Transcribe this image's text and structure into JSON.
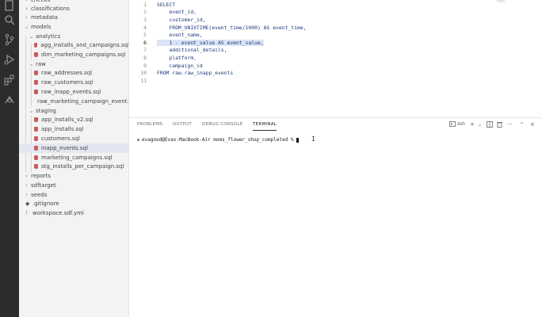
{
  "explorer": {
    "items": [
      {
        "label": "checks",
        "kind": "folder",
        "expanded": false
      },
      {
        "label": "classifications",
        "kind": "folder",
        "expanded": false
      },
      {
        "label": "metadata",
        "kind": "folder",
        "expanded": false
      },
      {
        "label": "models",
        "kind": "folder",
        "expanded": true
      },
      {
        "label": "analytics",
        "kind": "folder",
        "expanded": true
      },
      {
        "label": "agg_installs_and_campaigns.sql",
        "kind": "sql"
      },
      {
        "label": "dim_marketing_campaigns.sql",
        "kind": "sql"
      },
      {
        "label": "raw",
        "kind": "folder",
        "expanded": true
      },
      {
        "label": "raw_addresses.sql",
        "kind": "sql"
      },
      {
        "label": "raw_customers.sql",
        "kind": "sql"
      },
      {
        "label": "raw_inapp_events.sql",
        "kind": "sql"
      },
      {
        "label": "raw_marketing_campaign_event...",
        "kind": "sql"
      },
      {
        "label": "staging",
        "kind": "folder",
        "expanded": true
      },
      {
        "label": "app_installs_v2.sql",
        "kind": "sql"
      },
      {
        "label": "app_installs.sql",
        "kind": "sql"
      },
      {
        "label": "customers.sql",
        "kind": "sql"
      },
      {
        "label": "inapp_events.sql",
        "kind": "sql",
        "selected": true
      },
      {
        "label": "marketing_campaigns.sql",
        "kind": "sql"
      },
      {
        "label": "stg_installs_per_campaign.sql",
        "kind": "sql"
      },
      {
        "label": "reports",
        "kind": "folder",
        "expanded": false
      },
      {
        "label": "sdftarget",
        "kind": "folder",
        "expanded": false
      },
      {
        "label": "seeds",
        "kind": "folder",
        "expanded": false
      },
      {
        "label": ".gitignore",
        "kind": "git"
      },
      {
        "label": "workspace.sdf.yml",
        "kind": "yml"
      }
    ]
  },
  "editor": {
    "lines": [
      {
        "n": "1",
        "text": "SELECT"
      },
      {
        "n": "2",
        "text": "    event_id,"
      },
      {
        "n": "3",
        "text": "    customer_id,"
      },
      {
        "n": "4",
        "text": "    FROM_UNIXTIME(event_time/1000) AS event_time,"
      },
      {
        "n": "5",
        "text": "    event_name,"
      },
      {
        "n": "6",
        "text": "    1 - event_value AS event_value,"
      },
      {
        "n": "7",
        "text": "    additional_details,"
      },
      {
        "n": "8",
        "text": "    platform,"
      },
      {
        "n": "9",
        "text": "    campaign_id"
      },
      {
        "n": "10",
        "text": "FROM raw.raw_inapp_events"
      },
      {
        "n": "11",
        "text": ""
      }
    ]
  },
  "panel": {
    "tabs": [
      "PROBLEMS",
      "OUTPUT",
      "DEBUG CONSOLE",
      "TERMINAL"
    ],
    "shell": "zsh",
    "prompt": "evagood@Evas-MacBook-Air moms_flower_shop_completed %",
    "icons": [
      "terminal-icon",
      "plus-icon",
      "chevron-down-icon",
      "split-icon",
      "trash-icon",
      "more-icon",
      "close-icon"
    ]
  }
}
